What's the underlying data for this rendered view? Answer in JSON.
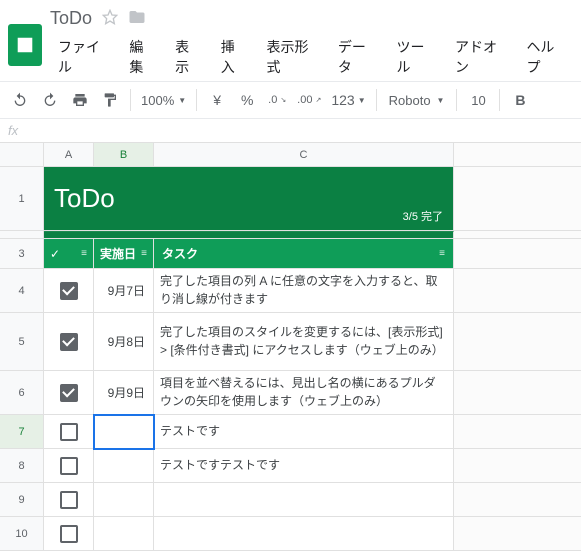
{
  "doc": {
    "title": "ToDo"
  },
  "menu": {
    "file": "ファイル",
    "edit": "編集",
    "view": "表示",
    "insert": "挿入",
    "format": "表示形式",
    "data": "データ",
    "tools": "ツール",
    "addons": "アドオン",
    "help": "ヘルプ"
  },
  "toolbar": {
    "zoom": "100%",
    "currency": "¥",
    "percent": "%",
    "dec_dec": ".0",
    "dec_inc": ".00",
    "numfmt": "123",
    "font": "Roboto",
    "size": "10"
  },
  "formula": {
    "fx": "fx"
  },
  "columns": {
    "A": "A",
    "B": "B",
    "C": "C"
  },
  "rows": [
    "1",
    "2",
    "3",
    "4",
    "5",
    "6",
    "7",
    "8",
    "9",
    "10"
  ],
  "sheet": {
    "title": "ToDo",
    "status": "3/5 完了",
    "headers": {
      "check": "✓",
      "date": "実施日",
      "task": "タスク"
    },
    "items": [
      {
        "done": true,
        "date": "9月7日",
        "task": "完了した項目の列 A に任意の文字を入力すると、取り消し線が付きます"
      },
      {
        "done": true,
        "date": "9月8日",
        "task": "完了した項目のスタイルを変更するには、[表示形式] > [条件付き書式] にアクセスします（ウェブ上のみ）"
      },
      {
        "done": true,
        "date": "9月9日",
        "task": "項目を並べ替えるには、見出し名の横にあるプルダウンの矢印を使用します（ウェブ上のみ）"
      },
      {
        "done": false,
        "date": "",
        "task": "テストです"
      },
      {
        "done": false,
        "date": "",
        "task": "テストですテストです"
      },
      {
        "done": false,
        "date": "",
        "task": ""
      },
      {
        "done": false,
        "date": "",
        "task": ""
      }
    ]
  }
}
